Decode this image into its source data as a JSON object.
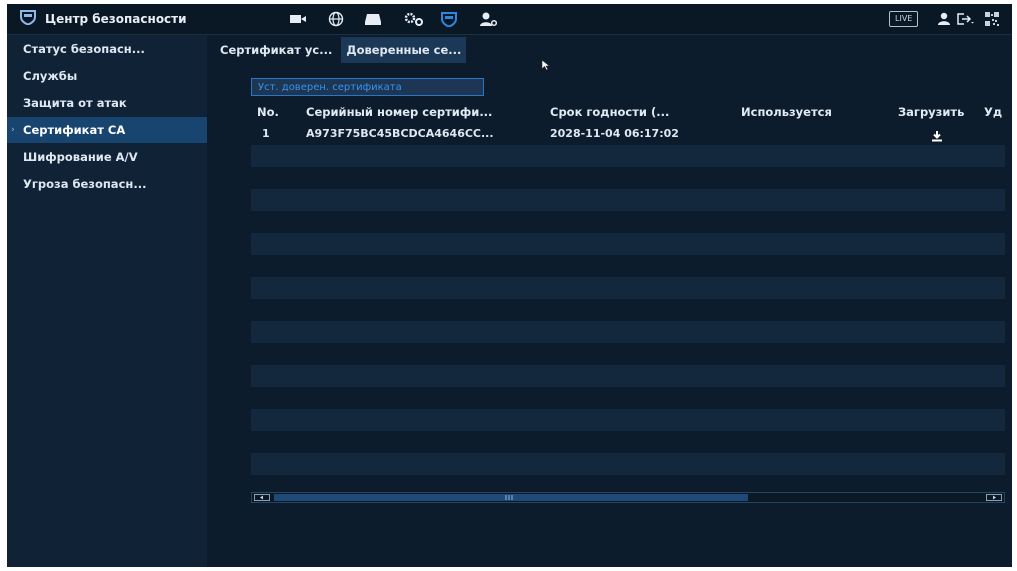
{
  "app": {
    "title": "Центр безопасности"
  },
  "topbar": {
    "icons": [
      "camera-icon",
      "network-icon",
      "storage-icon",
      "settings-icon",
      "security-shield-icon",
      "account-icon"
    ],
    "live_label": "LIVE",
    "right_icons": [
      "user-icon",
      "logout-icon",
      "qr-code-icon"
    ]
  },
  "sidebar": {
    "items": [
      {
        "label": "Статус безопасн..."
      },
      {
        "label": "Службы"
      },
      {
        "label": "Защита от атак"
      },
      {
        "label": "Сертификат CA"
      },
      {
        "label": "Шифрование A/V"
      },
      {
        "label": "Угроза безопасн..."
      }
    ],
    "active_index": 3
  },
  "tabs": [
    {
      "label": "Сертификат ус..."
    },
    {
      "label": "Доверенные се..."
    }
  ],
  "active_tab": 1,
  "install_button": {
    "label": "Уст. доверен. сертификата"
  },
  "table": {
    "columns": [
      "No.",
      "Серийный номер сертифи...",
      "Срок годности (...",
      "Используется",
      "Загрузить",
      "Уд"
    ],
    "rows": [
      {
        "no": "1",
        "serial": "A973F75BC45BCDCA4646CC...",
        "expiry": "2028-11-04 06:17:02",
        "in_use": "",
        "download_icon": "download-icon"
      }
    ]
  },
  "scrollbar": {
    "thumb_fraction": 0.63
  },
  "colors": {
    "accent": "#2a76c4",
    "active_bg": "#17456f",
    "bg": "#0d1c2c"
  }
}
